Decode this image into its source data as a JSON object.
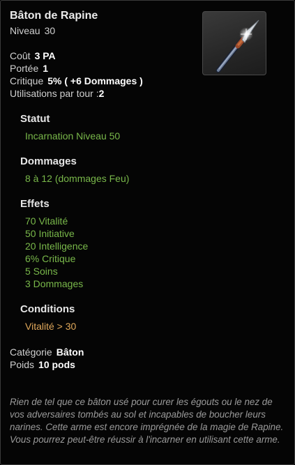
{
  "item": {
    "name": "Bâton de Rapine",
    "level_label": "Niveau",
    "level_value": "30"
  },
  "stats": {
    "cost_label": "Coût",
    "cost_value": "3 PA",
    "range_label": "Portée",
    "range_value": "1",
    "critical_label": "Critique",
    "critical_value": "5% ( +6 Dommages )",
    "uses_label": "Utilisations par tour :",
    "uses_value": "2"
  },
  "status": {
    "heading": "Statut",
    "value": "Incarnation Niveau 50"
  },
  "damage": {
    "heading": "Dommages",
    "value": "8 à 12 (dommages Feu)"
  },
  "effects": {
    "heading": "Effets",
    "items": [
      "70 Vitalité",
      "50 Initiative",
      "20 Intelligence",
      "6% Critique",
      "5 Soins",
      "3 Dommages"
    ]
  },
  "conditions": {
    "heading": "Conditions",
    "value": "Vitalité > 30"
  },
  "meta": {
    "category_label": "Catégorie",
    "category_value": "Bâton",
    "weight_label": "Poids",
    "weight_value": "10 pods"
  },
  "description": "Rien de tel que ce bâton usé pour curer les égouts ou le nez de vos adversaires tombés au sol et incapables de boucher leurs narines. Cette arme est encore imprégnée de la magie de Rapine. Vous pourrez peut-être réussir à l'incarner en utilisant cette arme.",
  "colors": {
    "effect_green": "#79b84a",
    "condition_orange": "#e0a85a",
    "description_grey": "#9a9a9a"
  },
  "icons": {
    "item_image": "spear-staff-icon"
  }
}
